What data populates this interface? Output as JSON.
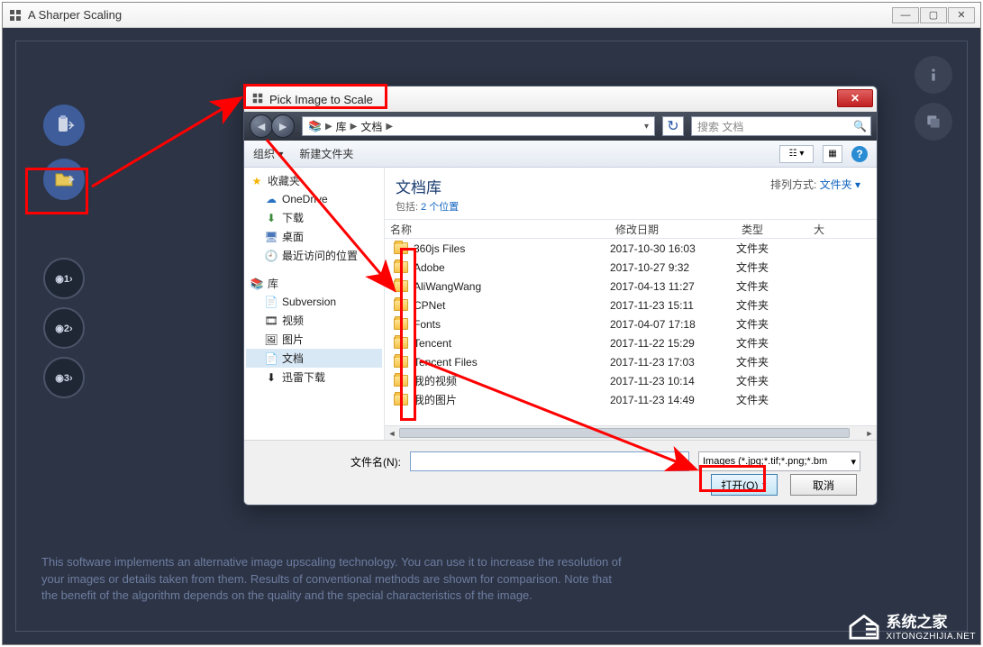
{
  "app": {
    "title": "A Sharper Scaling",
    "info_text": "This software implements an alternative image upscaling technology. You can use it to increase the resolution of your images or details taken from them. Results of conventional methods are shown for comparison. Note that the benefit of the algorithm depends on the quality and the special characteristics of the image."
  },
  "dialog": {
    "title": "Pick Image to Scale",
    "breadcrumb": {
      "seg1": "库",
      "seg2": "文档"
    },
    "search_placeholder": "搜索 文档",
    "toolbar": {
      "organize": "组织 ▾",
      "new_folder": "新建文件夹"
    },
    "header": {
      "title": "文档库",
      "sub_prefix": "包括: ",
      "sub_link": "2 个位置",
      "sort_label": "排列方式:",
      "sort_value": "文件夹 ▾"
    },
    "columns": {
      "name": "名称",
      "date": "修改日期",
      "type": "类型",
      "size": "大"
    },
    "rows": [
      {
        "name": "360js Files",
        "date": "2017-10-30 16:03",
        "type": "文件夹"
      },
      {
        "name": "Adobe",
        "date": "2017-10-27 9:32",
        "type": "文件夹"
      },
      {
        "name": "AliWangWang",
        "date": "2017-04-13 11:27",
        "type": "文件夹"
      },
      {
        "name": "CPNet",
        "date": "2017-11-23 15:11",
        "type": "文件夹"
      },
      {
        "name": "Fonts",
        "date": "2017-04-07 17:18",
        "type": "文件夹"
      },
      {
        "name": "Tencent",
        "date": "2017-11-22 15:29",
        "type": "文件夹"
      },
      {
        "name": "Tencent Files",
        "date": "2017-11-23 17:03",
        "type": "文件夹"
      },
      {
        "name": "我的视频",
        "date": "2017-11-23 10:14",
        "type": "文件夹"
      },
      {
        "name": "我的图片",
        "date": "2017-11-23 14:49",
        "type": "文件夹"
      }
    ],
    "tree": {
      "fav_head": "收藏夹",
      "fav": [
        {
          "label": "OneDrive"
        },
        {
          "label": "下载"
        },
        {
          "label": "桌面"
        },
        {
          "label": "最近访问的位置"
        }
      ],
      "lib_head": "库",
      "lib": [
        {
          "label": "Subversion"
        },
        {
          "label": "视频"
        },
        {
          "label": "图片"
        },
        {
          "label": "文档",
          "selected": true
        },
        {
          "label": "迅雷下载"
        }
      ]
    },
    "footer": {
      "filename_label": "文件名(N):",
      "filter": "Images (*.jpg;*.tif;*.png;*.bm",
      "open": "打开(O)",
      "cancel": "取消"
    }
  },
  "watermark": {
    "cn": "系统之家",
    "url": "XITONGZHIJIA.NET"
  }
}
